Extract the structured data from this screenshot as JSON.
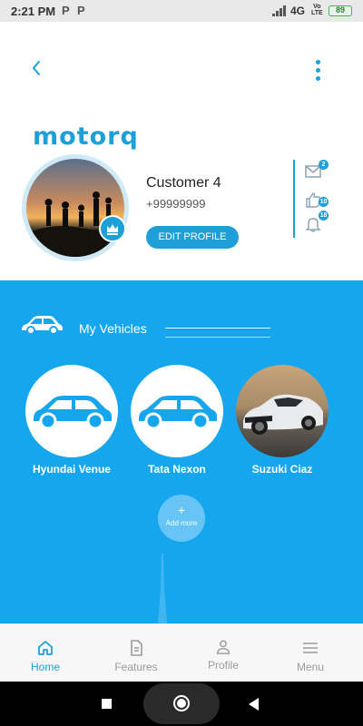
{
  "status_bar": {
    "time": "2:21 PM",
    "p1": "P",
    "p2": "P",
    "network": "4G",
    "volte_top": "Vo",
    "volte_bottom": "LTE",
    "battery": "89"
  },
  "header": {
    "back_icon": "chevron-left-icon",
    "menu_icon": "vertical-dots-icon",
    "logo_text": "motorq"
  },
  "profile": {
    "name": "Customer 4",
    "phone": "+99999999",
    "edit_label": "EDIT PROFILE",
    "crown_icon": "crown-icon"
  },
  "side_icons": [
    {
      "icon": "mail-icon",
      "badge": "2"
    },
    {
      "icon": "thumbs-up-icon",
      "badge": "10"
    },
    {
      "icon": "bell-icon",
      "badge": "18"
    }
  ],
  "vehicles_section": {
    "title": "My Vehicles",
    "items": [
      {
        "name": "Hyundai Venue",
        "image": "car-outline-icon"
      },
      {
        "name": "Tata Nexon",
        "image": "car-outline-icon"
      },
      {
        "name": "Suzuki Ciaz",
        "image": "car-photo"
      }
    ],
    "add_more": {
      "plus": "+",
      "label": "Add more"
    }
  },
  "bottom_nav": [
    {
      "label": "Home",
      "icon": "home-icon",
      "active": true
    },
    {
      "label": "Features",
      "icon": "document-icon",
      "active": false
    },
    {
      "label": "Profile",
      "icon": "person-icon",
      "active": false
    },
    {
      "label": "Menu",
      "icon": "hamburger-icon",
      "active": false
    }
  ],
  "colors": {
    "accent": "#1e9fd8",
    "section_blue": "#15a6ee",
    "nav_inactive": "#9a9a9a"
  }
}
